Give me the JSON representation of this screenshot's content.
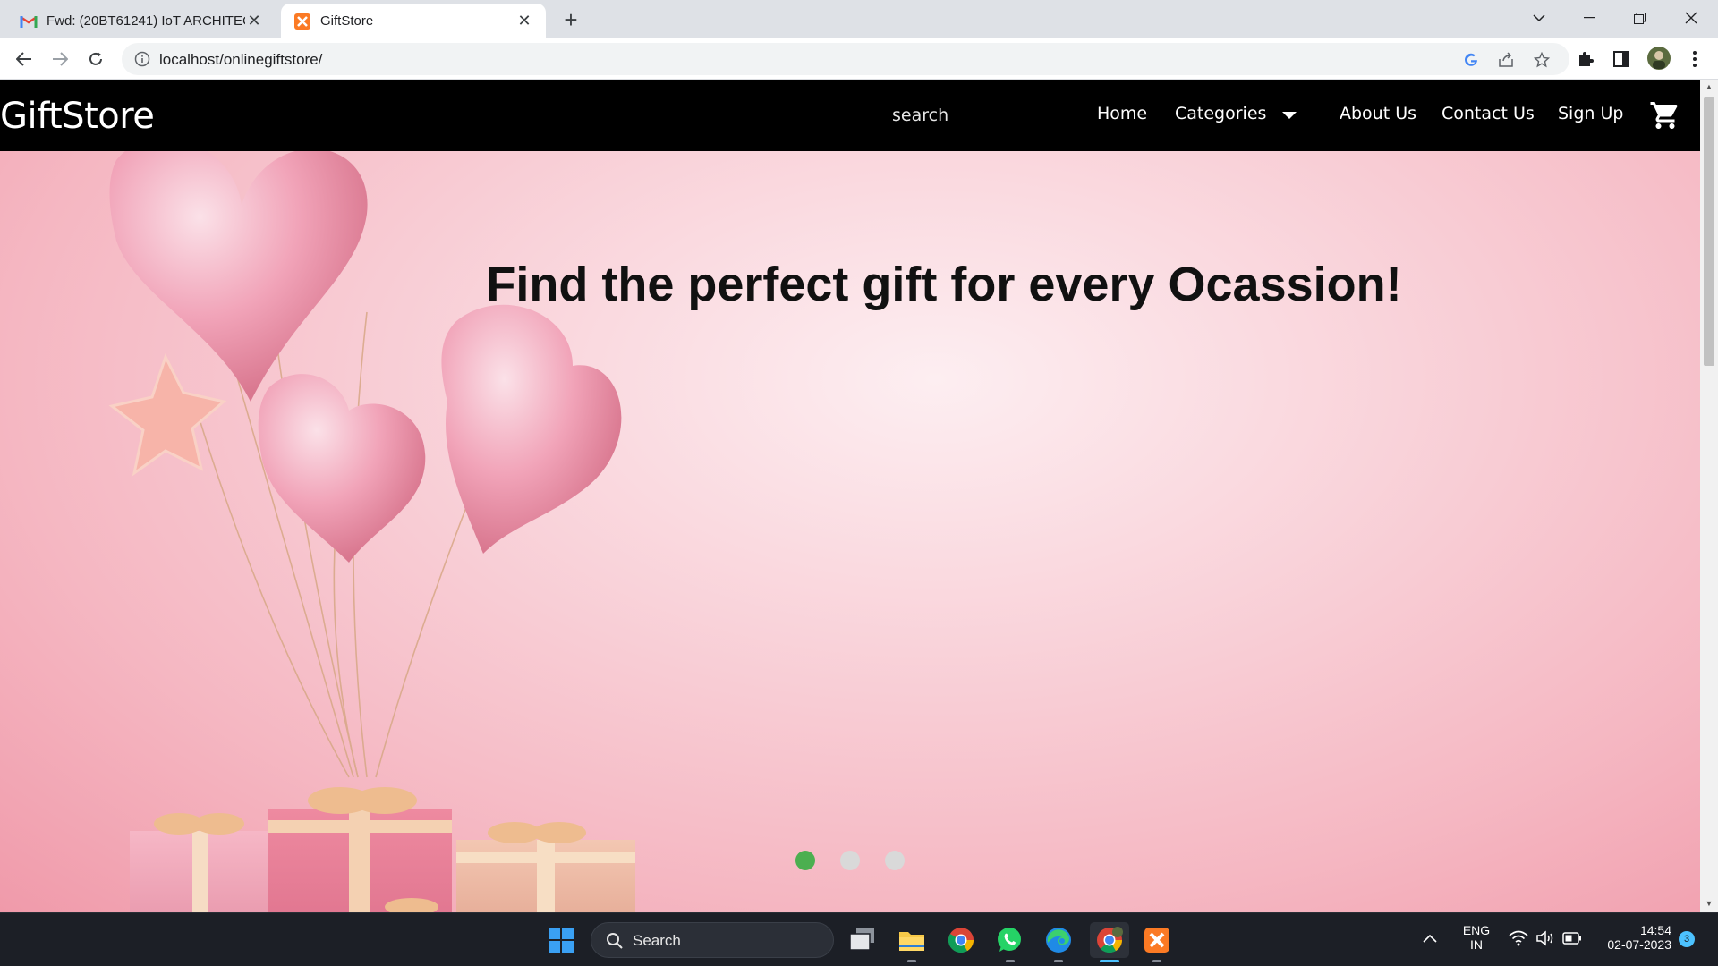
{
  "browser": {
    "tabs": [
      {
        "title": "Fwd: (20BT61241) IoT ARCHITECT",
        "active": false
      },
      {
        "title": "GiftStore",
        "active": true
      }
    ],
    "url": "localhost/onlinegiftstore/"
  },
  "site": {
    "brand": "GiftStore",
    "search_placeholder": "search",
    "nav": {
      "home": "Home",
      "categories": "Categories",
      "about": "About Us",
      "contact": "Contact Us",
      "signup": "Sign Up"
    }
  },
  "hero": {
    "headline": "Find the perfect gift for every Ocassion!",
    "slides": 3,
    "active_slide": 1,
    "dot_active_color": "#4caf50",
    "dot_inactive_color": "#d9d9d9"
  },
  "taskbar": {
    "search_label": "Search",
    "lang_top": "ENG",
    "lang_bottom": "IN",
    "time": "14:54",
    "date": "02-07-2023",
    "notification_count": "3"
  }
}
